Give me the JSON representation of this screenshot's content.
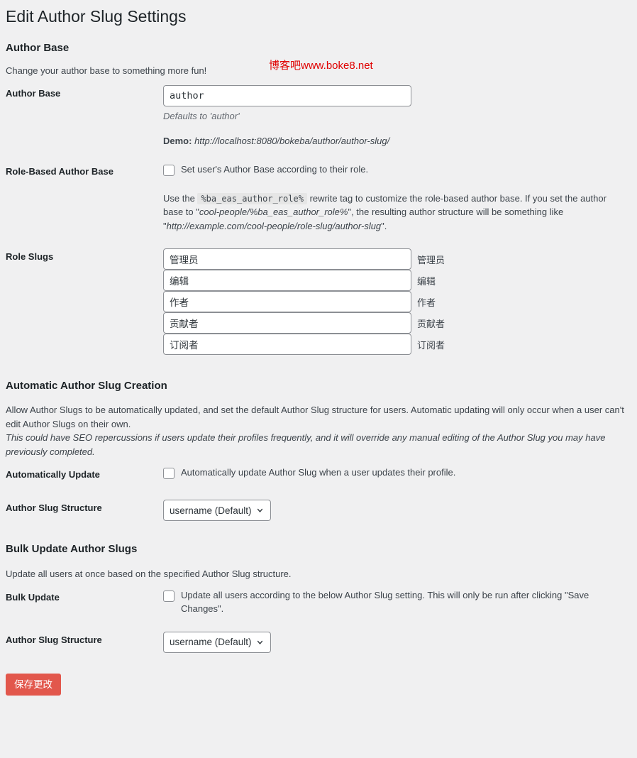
{
  "page": {
    "title": "Edit Author Slug Settings",
    "watermark": "博客吧www.boke8.net"
  },
  "author_base": {
    "heading": "Author Base",
    "description": "Change your author base to something more fun!",
    "field_label": "Author Base",
    "input_value": "author",
    "input_placeholder": "author",
    "input_description": "Defaults to 'author'",
    "demo_label": "Demo:",
    "demo_url": "http://localhost:8080/bokeba/author/author-slug/"
  },
  "role_based": {
    "field_label": "Role-Based Author Base",
    "checkbox_label": "Set user's Author Base according to their role.",
    "checked": false,
    "helper_prefix": "Use the",
    "helper_tag": "%ba_eas_author_role%",
    "helper_middle": "rewrite tag to customize the role-based author base. If you set the author base to \"",
    "helper_example_base": "cool-people/%ba_eas_author_role%",
    "helper_middle2": "\", the resulting author structure will be something like \"",
    "helper_example_url": "http://example.com/cool-people/role-slug/author-slug",
    "helper_suffix": "\"."
  },
  "role_slugs": {
    "field_label": "Role Slugs",
    "rows": [
      {
        "value": "管理员",
        "name": "管理员"
      },
      {
        "value": "编辑",
        "name": "编辑"
      },
      {
        "value": "作者",
        "name": "作者"
      },
      {
        "value": "贡献者",
        "name": "贡献者"
      },
      {
        "value": "订阅者",
        "name": "订阅者"
      }
    ]
  },
  "automatic": {
    "heading": "Automatic Author Slug Creation",
    "description_line1": "Allow Author Slugs to be automatically updated, and set the default Author Slug structure for users. Automatic updating will only occur when a user can't edit Author Slugs on their own.",
    "description_line2": "This could have SEO repercussions if users update their profiles frequently, and it will override any manual editing of the Author Slug you may have previously completed.",
    "auto_update_label": "Automatically Update",
    "auto_update_checkbox_label": "Automatically update Author Slug when a user updates their profile.",
    "auto_update_checked": false,
    "structure_label": "Author Slug Structure",
    "structure_value": "username (Default)",
    "structure_options": [
      "username (Default)"
    ]
  },
  "bulk": {
    "heading": "Bulk Update Author Slugs",
    "description": "Update all users at once based on the specified Author Slug structure.",
    "bulk_label": "Bulk Update",
    "bulk_checkbox_label": "Update all users according to the below Author Slug setting. This will only be run after clicking \"Save Changes\".",
    "bulk_checked": false,
    "structure_label": "Author Slug Structure",
    "structure_value": "username (Default)",
    "structure_options": [
      "username (Default)"
    ]
  },
  "submit": {
    "save_label": "保存更改",
    "color": "#e2574c"
  }
}
